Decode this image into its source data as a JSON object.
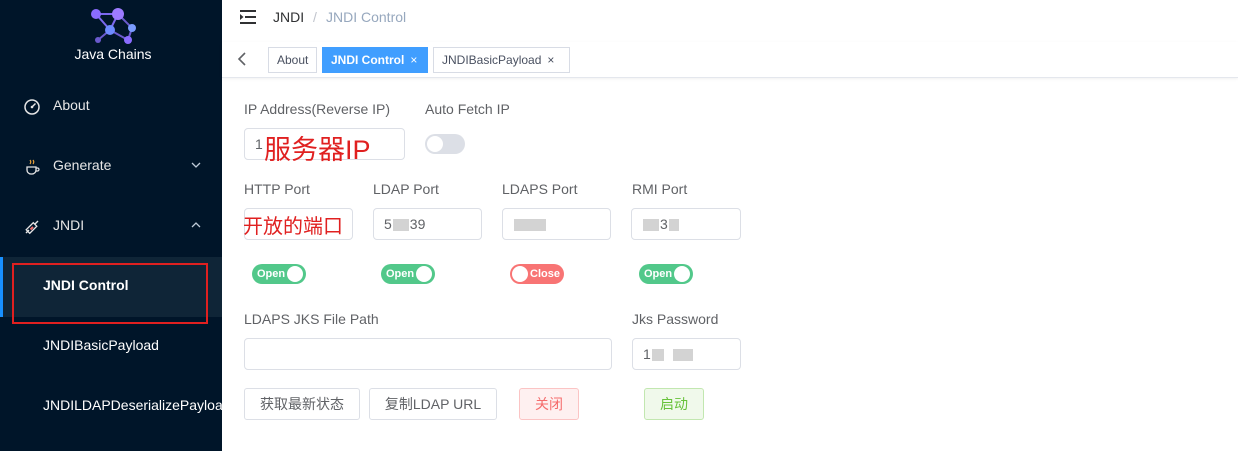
{
  "app": {
    "name": "Java Chains"
  },
  "sidebar": {
    "items": [
      {
        "label": "About",
        "icon": "gauge-icon"
      },
      {
        "label": "Generate",
        "icon": "java-cup-icon"
      },
      {
        "label": "JNDI",
        "icon": "syringe-icon"
      }
    ],
    "sub_items": [
      {
        "label": "JNDI Control",
        "active": true
      },
      {
        "label": "JNDIBasicPayload"
      },
      {
        "label": "JNDILDAPDeserializePayload"
      }
    ]
  },
  "breadcrumb": {
    "parent": "JNDI",
    "separator": "/",
    "current": "JNDI Control"
  },
  "tags": [
    {
      "label": "About"
    },
    {
      "label": "JNDI Control",
      "active": true,
      "close": "×"
    },
    {
      "label": "JNDIBasicPayload",
      "close": "×"
    }
  ],
  "form": {
    "ip": {
      "label": "IP Address(Reverse IP)",
      "value": "1",
      "annotation": "服务器IP"
    },
    "auto_fetch": {
      "label": "Auto Fetch IP",
      "on": false
    },
    "http_port": {
      "label": "HTTP Port",
      "annotation": "开放的端口"
    },
    "ldap_port": {
      "label": "LDAP Port",
      "value_start": "5",
      "value_end": "39"
    },
    "ldaps_port": {
      "label": "LDAPS Port"
    },
    "rmi_port": {
      "label": "RMI Port",
      "value_start": "",
      "value_end": "3"
    },
    "toggles": [
      {
        "text": "Open",
        "on": true
      },
      {
        "text": "Open",
        "on": true
      },
      {
        "text": "Close",
        "on": false
      },
      {
        "text": "Open",
        "on": true
      }
    ],
    "jks_path": {
      "label": "LDAPS JKS File Path",
      "value": ""
    },
    "jks_password": {
      "label": "Jks Password",
      "value_start": "1"
    }
  },
  "buttons": {
    "refresh": "获取最新状态",
    "copy": "复制LDAP URL",
    "stop": "关闭",
    "start": "启动"
  },
  "colors": {
    "sidebar_bg": "#001529",
    "accent": "#409eff",
    "switch_on": "#52c88a",
    "switch_off": "#f87474",
    "annotation": "#e02020"
  }
}
